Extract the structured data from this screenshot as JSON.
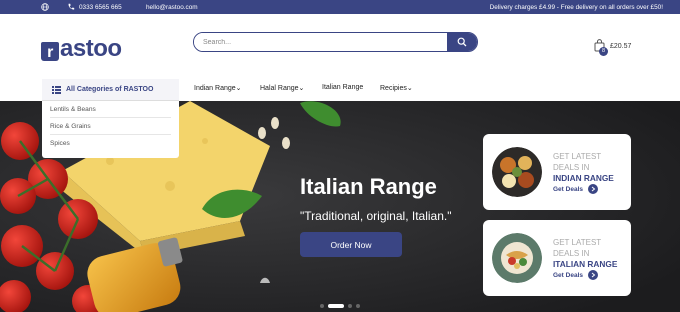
{
  "topbar": {
    "phone": "0333 6565 665",
    "email": "hello@rastoo.com",
    "delivery": "Delivery charges £4.99 - Free delivery on all orders over £50!"
  },
  "header": {
    "logo_text": "astoo",
    "logo_bag_letter": "r",
    "search_placeholder": "Search...",
    "cart_total": "£20.57",
    "cart_count": "8"
  },
  "nav": {
    "all_categories": "All Categories of RASTOO",
    "items": [
      {
        "label": "Indian Range",
        "dropdown": "⌄"
      },
      {
        "label": "Halal Range",
        "dropdown": "⌄"
      },
      {
        "label": "Italian Range",
        "dropdown": ""
      },
      {
        "label": "Recipies",
        "dropdown": "⌄"
      }
    ]
  },
  "categories": [
    "Lentils & Beans",
    "Rice & Grains",
    "Spices"
  ],
  "hero": {
    "title": "Italian Range",
    "subtitle": "\"Traditional, original, Italian.\"",
    "cta": "Order Now"
  },
  "promo_cards": [
    {
      "line1": "GET LATEST",
      "line2": "DEALS IN",
      "range": "INDIAN RANGE",
      "link": "Get Deals"
    },
    {
      "line1": "GET LATEST",
      "line2": "DEALS IN",
      "range": "ITALIAN RANGE",
      "link": "Get Deals"
    }
  ],
  "carousel": {
    "slides": 4,
    "active": 2
  },
  "colors": {
    "brand": "#3a4584",
    "hero_bg": "#2b2b2d",
    "accent_text": "#aaaaaa"
  },
  "icons": [
    "globe-icon",
    "phone-icon",
    "search-icon",
    "bag-icon",
    "menu-list-icon",
    "arrow-right-icon"
  ]
}
